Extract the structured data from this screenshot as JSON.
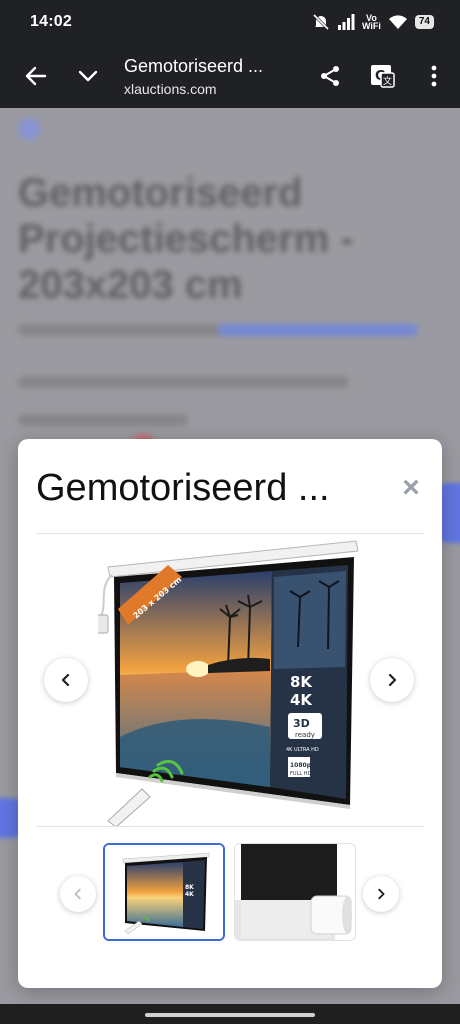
{
  "status_bar": {
    "time": "14:02",
    "wifi_label_top": "Vo",
    "wifi_label_bottom": "WiFi",
    "battery": "74",
    "icons": [
      "mute-icon",
      "signal-icon",
      "wifi-calling-icon",
      "wifi-icon",
      "battery-icon"
    ]
  },
  "toolbar": {
    "title": "Gemotoriseerd ...",
    "url": "xlauctions.com",
    "icons": [
      "back-arrow-icon",
      "chevron-down-icon",
      "share-icon",
      "translate-icon",
      "more-vert-icon"
    ]
  },
  "background_page": {
    "heading": "Gemotoriseerd Projectiescherm - 203x203 cm"
  },
  "modal": {
    "title": "Gemotoriseerd ...",
    "close_label": "×",
    "main_image": {
      "subject": "motorized projection screen with beach sunset",
      "badge_text": "203 x 203 cm",
      "overlay_8k": "8K",
      "overlay_4k": "4K",
      "overlay_3d": "3D",
      "overlay_ready": "ready",
      "overlay_4k_ultra": "4K ULTRA HD",
      "overlay_1080": "1080p",
      "overlay_fullhd": "FULL HD"
    },
    "thumbnails": [
      {
        "subject": "projection screen",
        "selected": true
      },
      {
        "subject": "screen casing close-up",
        "selected": false
      }
    ],
    "colors": {
      "selected_border": "#3d6cd8",
      "close_icon": "#9aa0aa"
    }
  }
}
